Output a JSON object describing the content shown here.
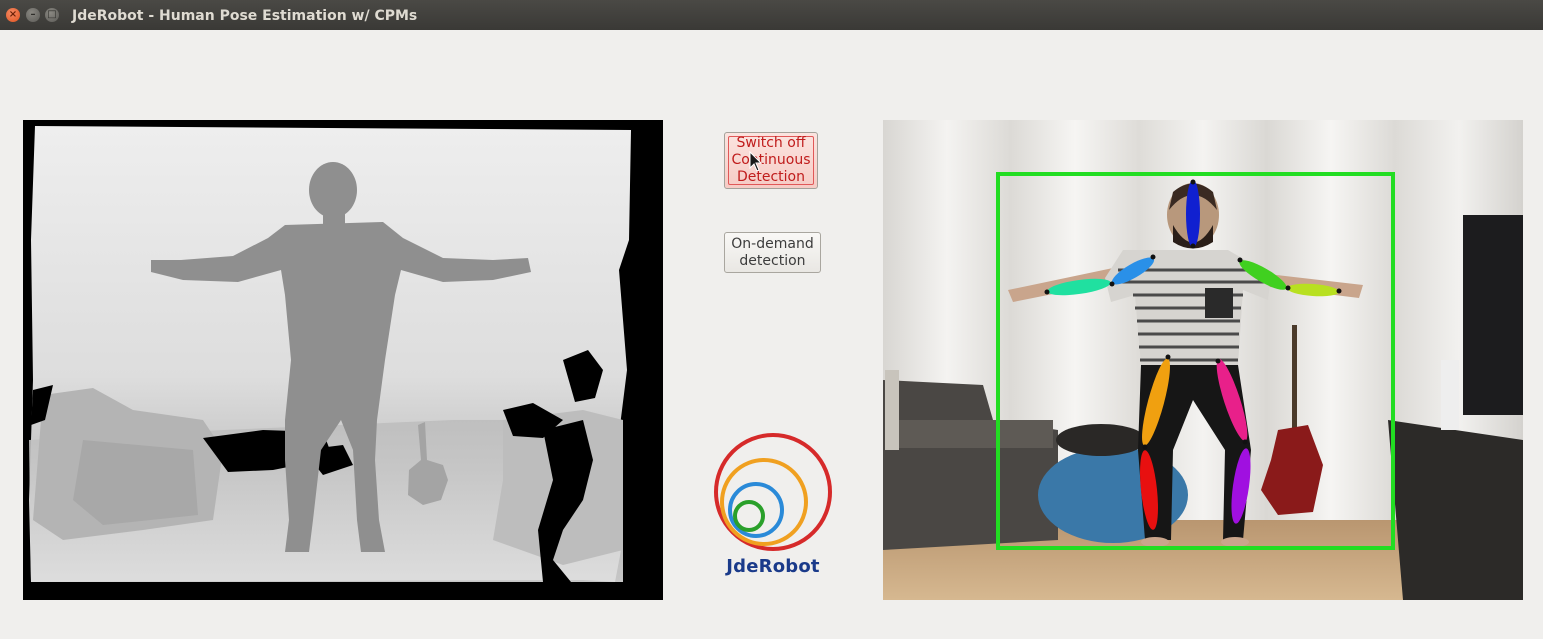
{
  "window": {
    "title": "JdeRobot - Human Pose Estimation w/ CPMs",
    "controls": [
      "close",
      "minimize",
      "maximize"
    ]
  },
  "buttons": {
    "continuous": {
      "label_line1": "Switch off",
      "label_line2": "Continuous",
      "label_line3": "Detection",
      "state": "active",
      "color": "#c01c1c"
    },
    "on_demand": {
      "label_line1": "On-demand",
      "label_line2": "detection"
    }
  },
  "logo": {
    "text": "JdeRobot",
    "ring_colors": [
      "#d62a2a",
      "#f0a020",
      "#2a8ad8",
      "#2aa02a"
    ]
  },
  "panels": {
    "depth": {
      "type": "depth-image"
    },
    "rgb": {
      "type": "camera-image",
      "bounding_box_color": "#22dd22",
      "limb_colors": {
        "head": "#1020d0",
        "right_upper_arm": "#2a90e8",
        "right_forearm": "#20e0a0",
        "left_upper_arm": "#40d020",
        "left_forearm": "#b8e020",
        "right_thigh": "#f0a010",
        "right_shin": "#e81010",
        "left_thigh": "#e8208a",
        "left_shin": "#a010e0"
      }
    }
  }
}
